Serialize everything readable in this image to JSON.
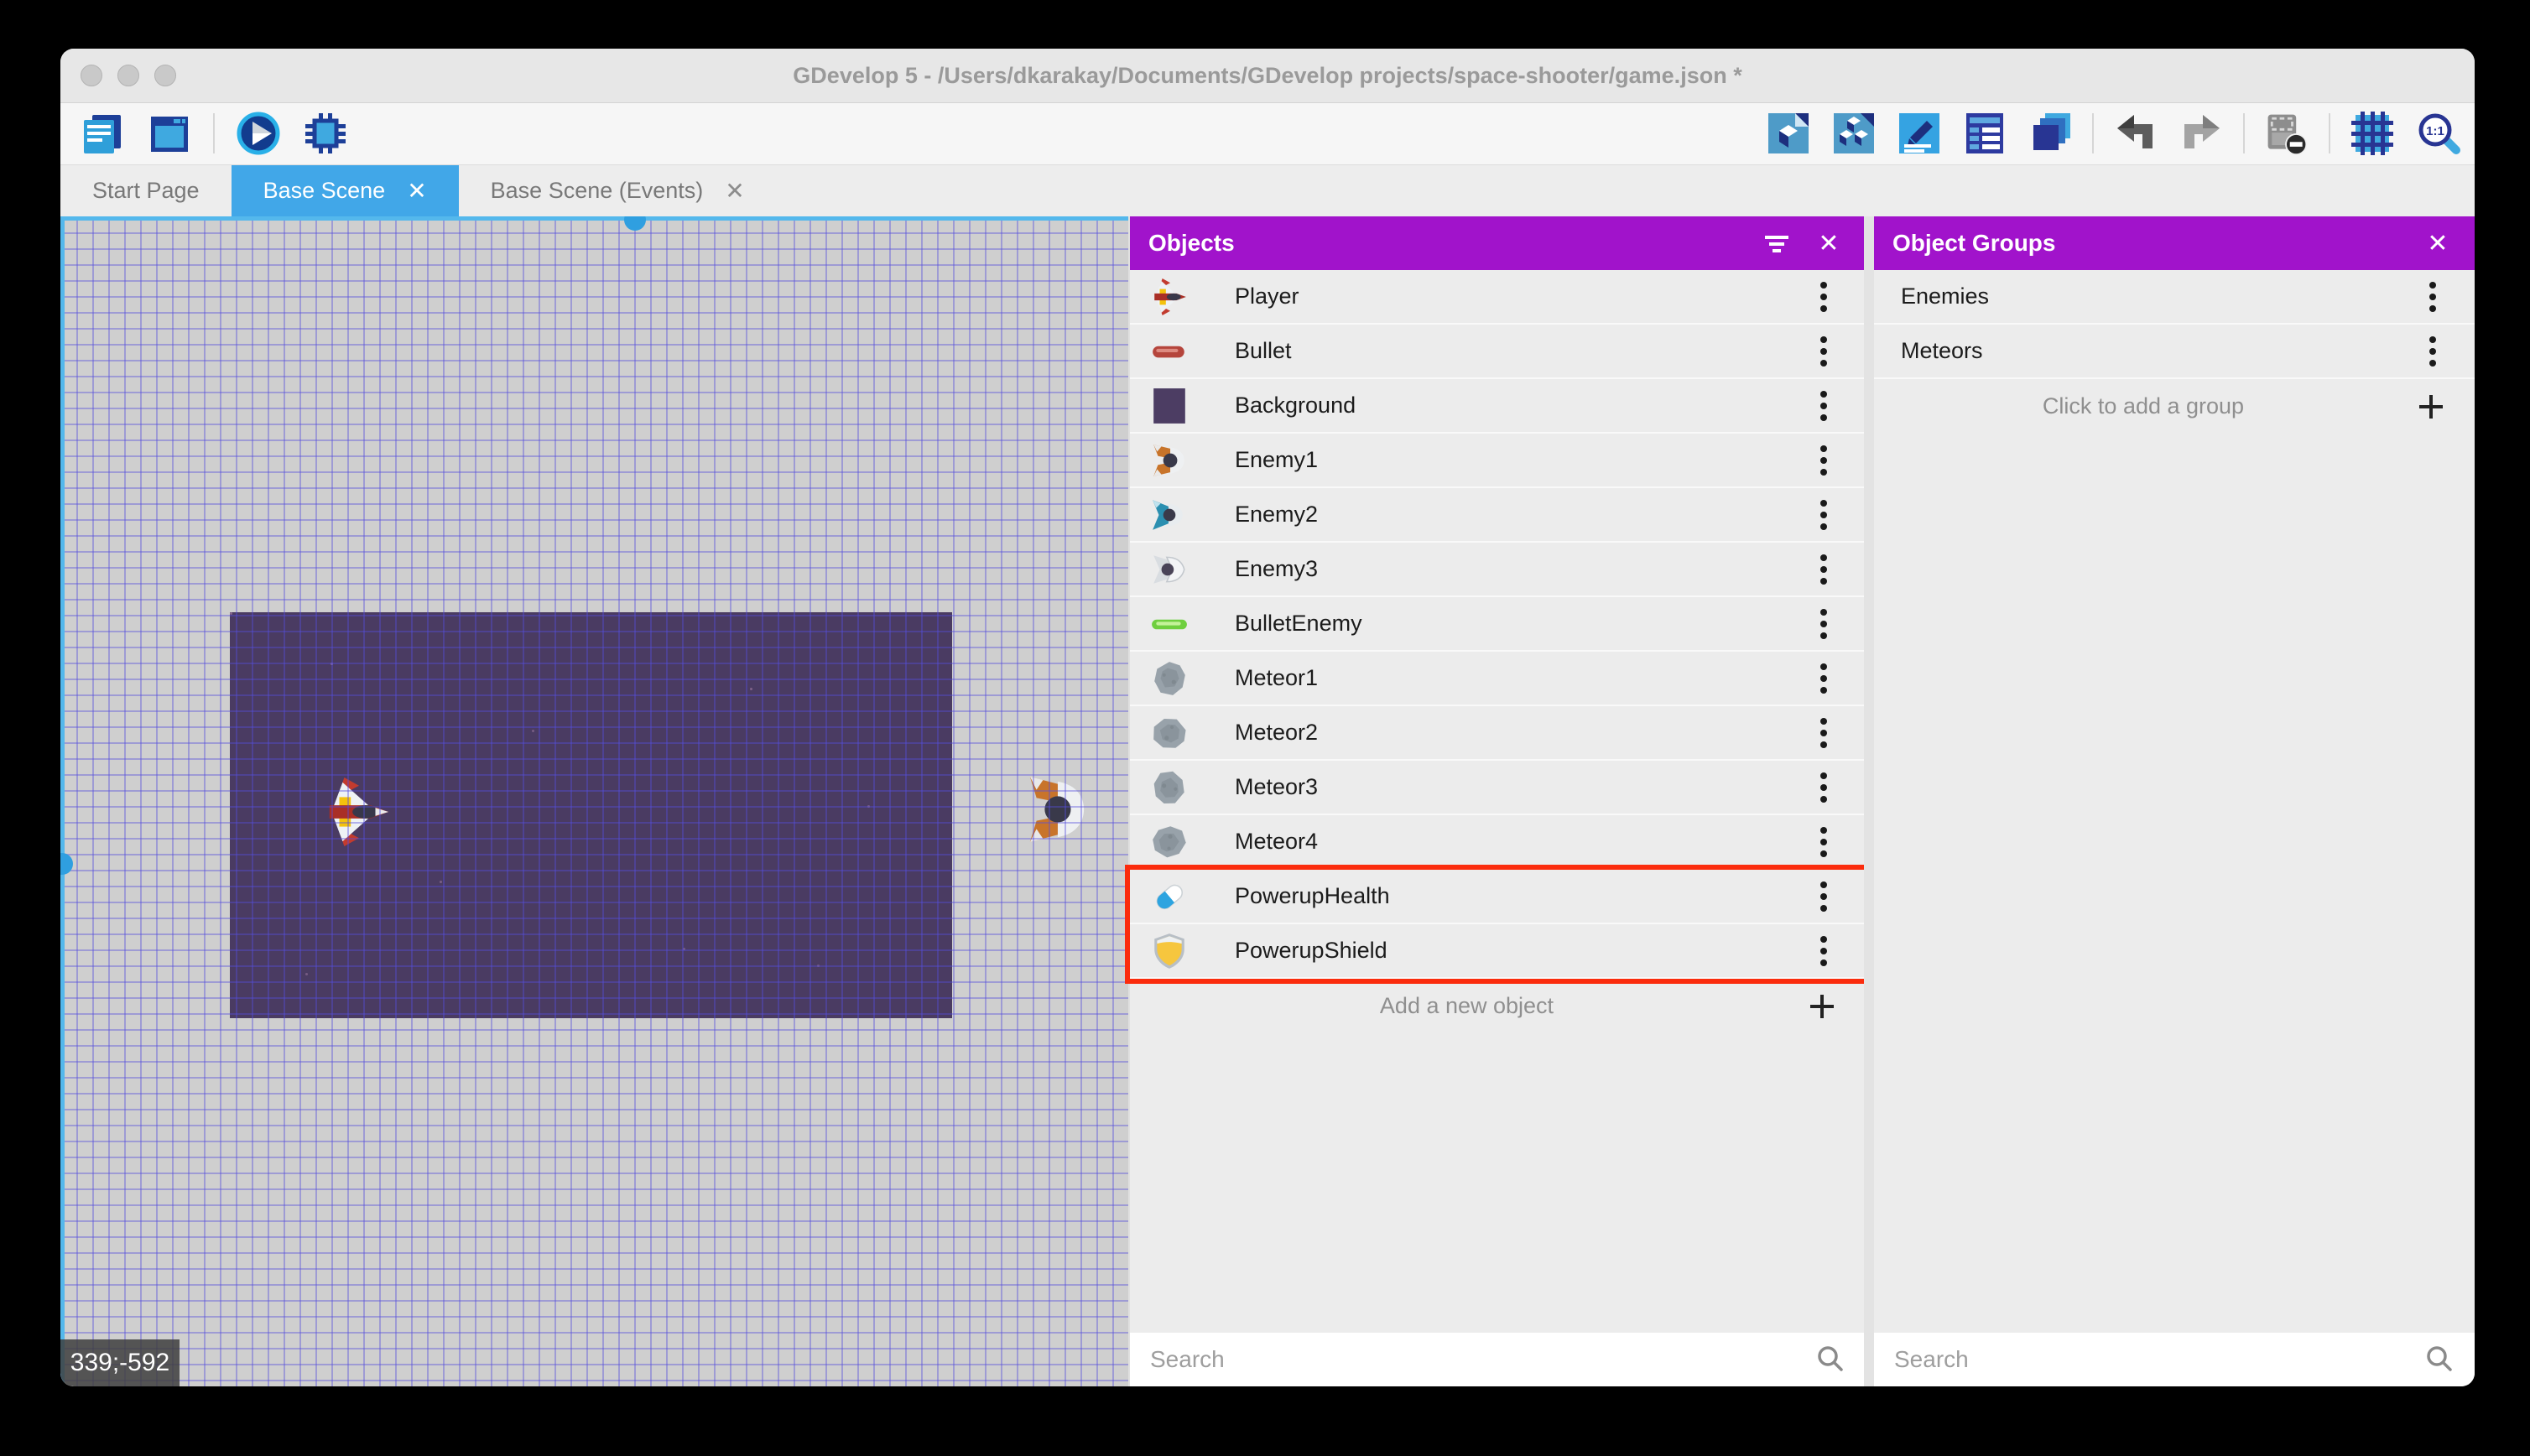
{
  "window": {
    "title": "GDevelop 5 - /Users/dkarakay/Documents/GDevelop projects/space-shooter/game.json *"
  },
  "toolbar": {
    "left_icons": [
      "project-manager",
      "scene-window",
      "play",
      "debug"
    ],
    "right_icons": [
      "objects-editor",
      "object-groups-editor",
      "properties",
      "instances-list",
      "layers",
      "undo",
      "redo",
      "window-mask",
      "grid",
      "zoom-1-1"
    ]
  },
  "tabs": [
    {
      "label": "Start Page",
      "active": false
    },
    {
      "label": "Base Scene",
      "active": true,
      "close": "✕"
    },
    {
      "label": "Base Scene (Events)",
      "active": false,
      "close": "✕"
    }
  ],
  "canvas": {
    "coordinates_badge": "339;-592"
  },
  "objects_panel": {
    "title": "Objects",
    "close": "✕",
    "items": [
      {
        "label": "Player",
        "icon": "player-icon"
      },
      {
        "label": "Bullet",
        "icon": "bullet-icon"
      },
      {
        "label": "Background",
        "icon": "background-icon"
      },
      {
        "label": "Enemy1",
        "icon": "enemy1-icon"
      },
      {
        "label": "Enemy2",
        "icon": "enemy2-icon"
      },
      {
        "label": "Enemy3",
        "icon": "enemy3-icon"
      },
      {
        "label": "BulletEnemy",
        "icon": "bullet-enemy-icon"
      },
      {
        "label": "Meteor1",
        "icon": "meteor-icon"
      },
      {
        "label": "Meteor2",
        "icon": "meteor-icon"
      },
      {
        "label": "Meteor3",
        "icon": "meteor-icon"
      },
      {
        "label": "Meteor4",
        "icon": "meteor-icon"
      },
      {
        "label": "PowerupHealth",
        "icon": "powerup-health-icon"
      },
      {
        "label": "PowerupShield",
        "icon": "powerup-shield-icon"
      }
    ],
    "highlighted_items": [
      "PowerupHealth",
      "PowerupShield"
    ],
    "add_button_label": "Add a new object",
    "search_placeholder": "Search"
  },
  "object_groups_panel": {
    "title": "Object Groups",
    "close": "✕",
    "groups": [
      {
        "label": "Enemies"
      },
      {
        "label": "Meteors"
      }
    ],
    "add_button_label": "Click to add a group",
    "search_placeholder": "Search"
  },
  "colors": {
    "panel_header_purple": "#a113cb",
    "active_tab_blue": "#41a7e8",
    "highlight_red": "#fb2c0d",
    "scene_border_blue": "#54b8ec",
    "background_object_purple": "#4a3b62",
    "canvas_gray": "#cfcfcf"
  }
}
